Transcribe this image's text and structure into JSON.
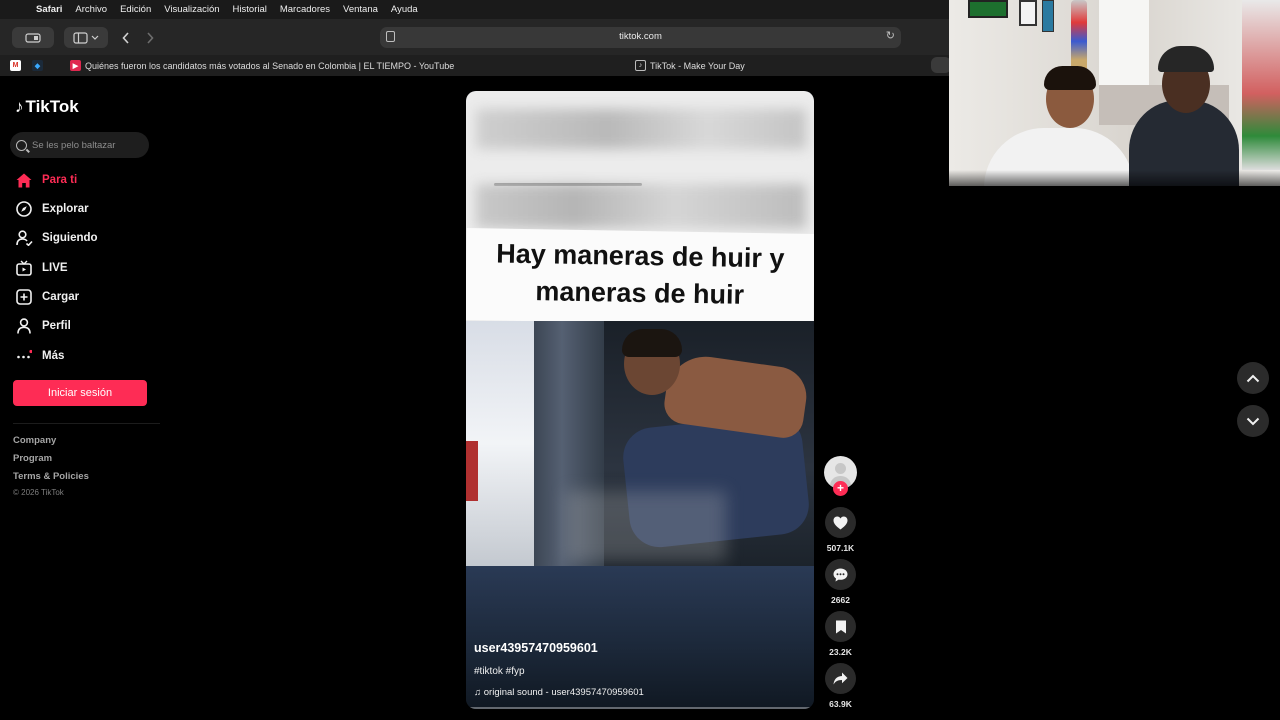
{
  "menubar": {
    "apple": "",
    "items": [
      "Safari",
      "Archivo",
      "Edición",
      "Visualización",
      "Historial",
      "Marcadores",
      "Ventana",
      "Ayuda"
    ]
  },
  "toolbar": {
    "url": "tiktok.com"
  },
  "tabs": [
    {
      "title": "Quiénes fueron los candidatos más votados al Senado en Colombia | EL TIEMPO - YouTube"
    },
    {
      "title": "TikTok - Make Your Day"
    }
  ],
  "sidebar": {
    "brand": "TikTok",
    "search_placeholder": "Se les pelo baltazar",
    "nav": [
      {
        "label": "Para ti",
        "icon": "home-icon",
        "active": true
      },
      {
        "label": "Explorar",
        "icon": "compass-icon"
      },
      {
        "label": "Siguiendo",
        "icon": "following-icon"
      },
      {
        "label": "LIVE",
        "icon": "live-tv-icon"
      },
      {
        "label": "Cargar",
        "icon": "upload-icon"
      },
      {
        "label": "Perfil",
        "icon": "profile-icon"
      },
      {
        "label": "Más",
        "icon": "more-icon"
      }
    ],
    "login_label": "Iniciar sesión",
    "footer_links": [
      "Company",
      "Program",
      "Terms & Policies"
    ],
    "copyright": "© 2026 TikTok"
  },
  "video": {
    "caption": "Hay maneras de huir y maneras de huir",
    "username": "user43957470959601",
    "hashtags": "#tiktok #fyp",
    "sound": "original sound - user43957470959601"
  },
  "actions": {
    "follow_symbol": "+",
    "likes": "507.1K",
    "comments": "2662",
    "saves": "23.2K",
    "shares": "63.9K"
  },
  "colors": {
    "accent": "#fe2c55",
    "background": "#000000"
  }
}
